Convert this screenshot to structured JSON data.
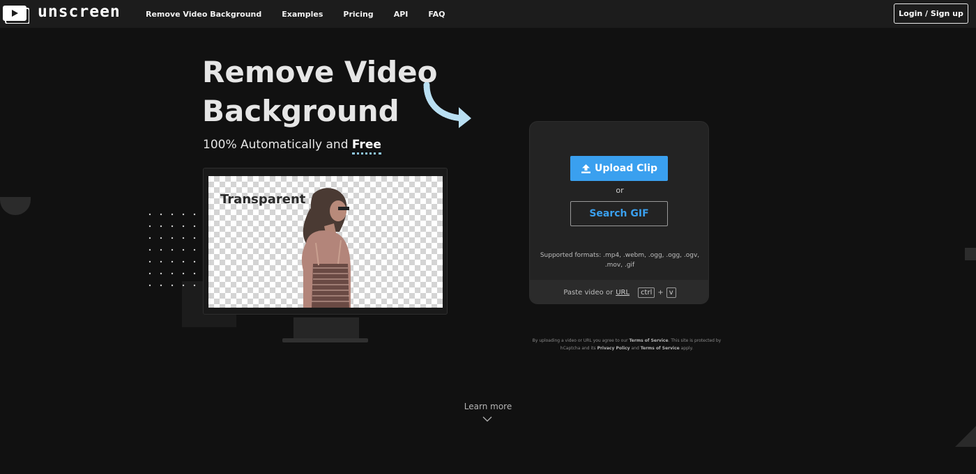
{
  "brand": {
    "name": "unscreen"
  },
  "nav": {
    "links": [
      "Remove Video Background",
      "Examples",
      "Pricing",
      "API",
      "FAQ"
    ],
    "login_label": "Login / Sign up"
  },
  "hero": {
    "title_line1": "Remove Video",
    "title_line2": "Background",
    "subtitle_prefix": "100% Automatically and ",
    "subtitle_emphasis": "Free",
    "preview_label": "Transparent"
  },
  "upload_card": {
    "upload_label": "Upload Clip",
    "or_label": "or",
    "search_label": "Search GIF",
    "formats_text": "Supported formats: .mp4, .webm, .ogg, .ogg, .ogv, .mov, .gif",
    "paste_prefix": "Paste video or",
    "paste_url": "URL",
    "key_ctrl": "ctrl",
    "key_plus": "+",
    "key_v": "v"
  },
  "terms": {
    "t1": "By uploading a video or URL you agree to our ",
    "tos": "Terms of Service",
    "t2": ". This site is protected by hCaptcha and its ",
    "privacy": "Privacy Policy",
    "t3": " and ",
    "tos2": "Terms of Service",
    "t4": " apply."
  },
  "footer": {
    "learn_more": "Learn more"
  },
  "colors": {
    "background": "#111111",
    "nav": "#1c1c1c",
    "accent": "#3aa0ef",
    "card": "#232323"
  },
  "icons": {
    "logo": "play-screen-icon",
    "upload": "upload-icon",
    "arrow": "curved-arrow-icon",
    "learn_more": "chevron-down-icon"
  }
}
